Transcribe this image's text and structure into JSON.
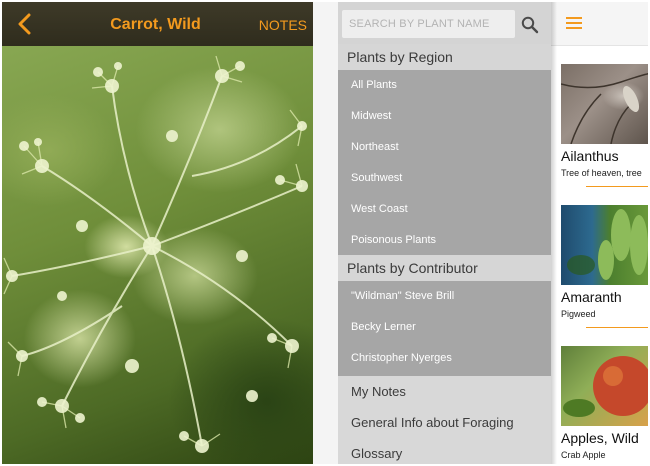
{
  "detail": {
    "title": "Carrot, Wild",
    "notes_label": "NOTES",
    "back_icon": "chevron-left-icon"
  },
  "menu": {
    "search_placeholder": "SEARCH BY PLANT NAME",
    "region_header": "Plants by Region",
    "regions": [
      "All Plants",
      "Midwest",
      "Northeast",
      "Southwest",
      "West Coast",
      "Poisonous Plants"
    ],
    "contributor_header": "Plants by Contributor",
    "contributors": [
      "\"Wildman\" Steve Brill",
      "Becky Lerner",
      "Christopher Nyerges"
    ],
    "bottom_items": [
      "My Notes",
      "General Info about Foraging",
      "Glossary"
    ]
  },
  "list": {
    "plants": [
      {
        "name": "Ailanthus",
        "sub": "Tree of heaven, tree"
      },
      {
        "name": "Amaranth",
        "sub": "Pigweed"
      },
      {
        "name": "Apples, Wild",
        "sub": "Crab Apple"
      }
    ]
  },
  "colors": {
    "accent": "#f39a1e",
    "menu_gray": "#a6a6a6",
    "header_gray": "#d6d6d6"
  }
}
